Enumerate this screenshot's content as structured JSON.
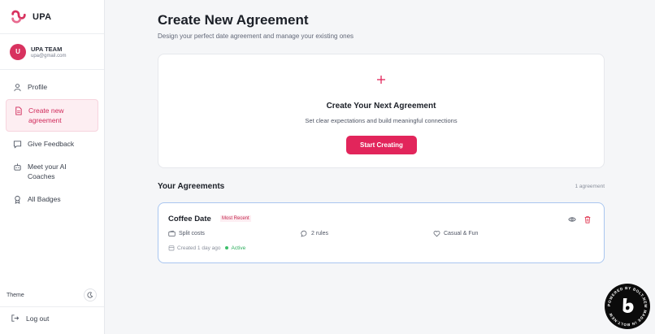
{
  "brand": {
    "name": "UPA",
    "accent": "#d8325f"
  },
  "user": {
    "initial": "U",
    "name": "UPA TEAM",
    "email": "upa@gmail.com"
  },
  "nav": {
    "items": [
      {
        "label": "Profile",
        "icon": "user-icon",
        "active": false
      },
      {
        "label": "Create new agreement",
        "icon": "document-icon",
        "active": true
      },
      {
        "label": "Give Feedback",
        "icon": "message-icon",
        "active": false
      },
      {
        "label": "Meet your AI Coaches",
        "icon": "robot-icon",
        "active": false
      },
      {
        "label": "All Badges",
        "icon": "award-icon",
        "active": false
      }
    ]
  },
  "theme": {
    "label": "Theme",
    "icon": "moon-icon"
  },
  "logout": {
    "label": "Log out",
    "icon": "logout-icon"
  },
  "page": {
    "title": "Create New Agreement",
    "subtitle": "Design your perfect date agreement and manage your existing ones"
  },
  "create_card": {
    "icon": "plus-icon",
    "title": "Create Your Next Agreement",
    "subtitle": "Set clear expectations and build meaningful connections",
    "button": "Start Creating"
  },
  "agreements": {
    "title": "Your Agreements",
    "count": "1 agreement",
    "items": [
      {
        "title": "Coffee Date",
        "badge": "Most Recent",
        "meta": [
          {
            "icon": "wallet-icon",
            "text": "Split costs"
          },
          {
            "icon": "chat-icon",
            "text": "2 rules"
          },
          {
            "icon": "heart-icon",
            "text": "Casual & Fun"
          }
        ],
        "created": "Created 1 day ago",
        "status": "Active"
      }
    ]
  },
  "bolt_badge": {
    "text": "POWERED BY BOLT.NEW MADE IN BOLT.NEW"
  }
}
